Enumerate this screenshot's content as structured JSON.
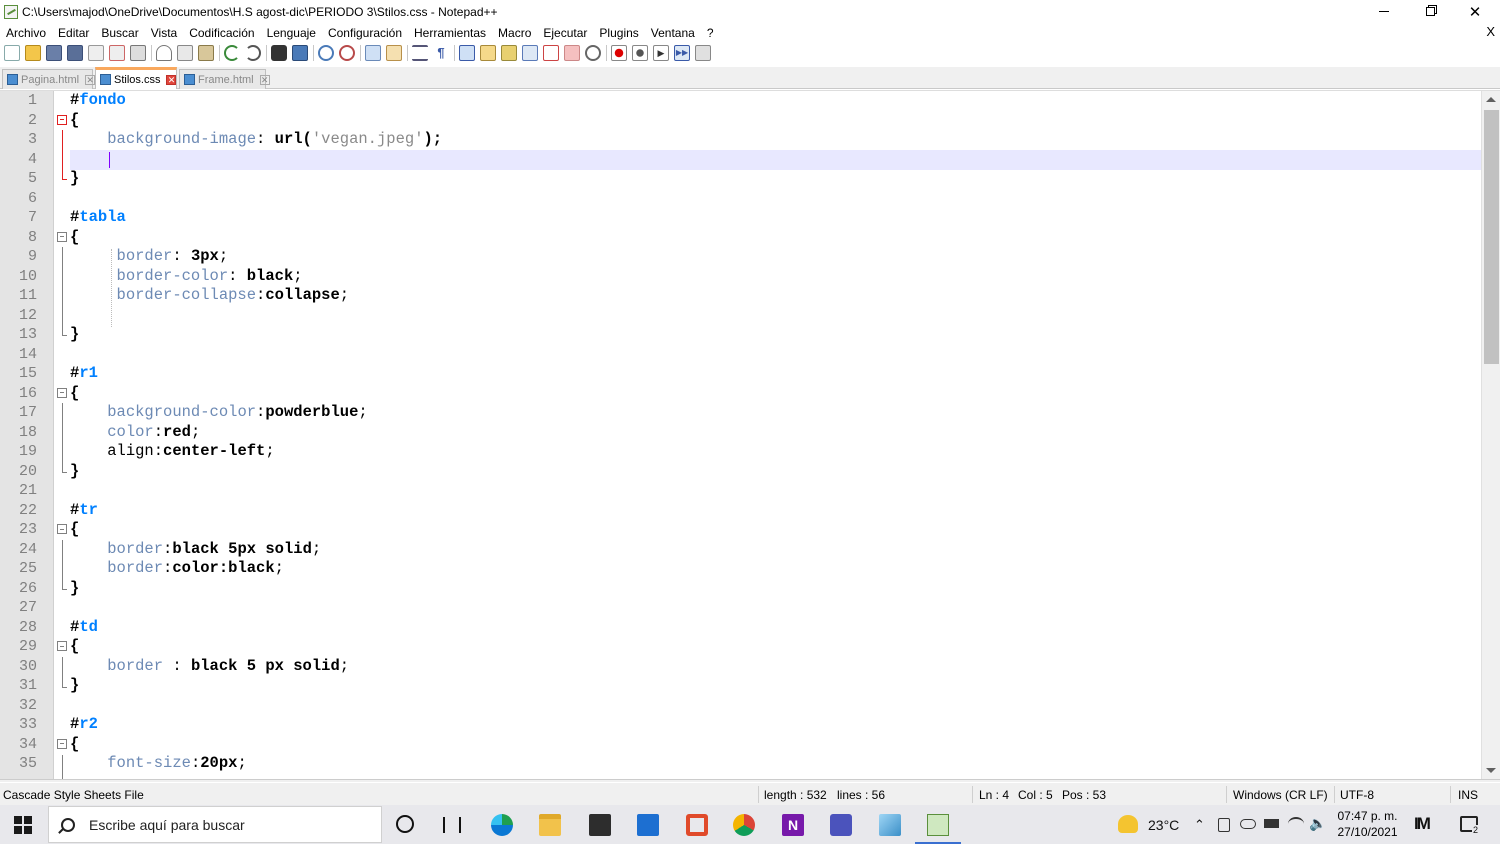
{
  "window": {
    "title": "C:\\Users\\majod\\OneDrive\\Documentos\\H.S agost-dic\\PERIODO 3\\Stilos.css - Notepad++"
  },
  "menu": [
    "Archivo",
    "Editar",
    "Buscar",
    "Vista",
    "Codificación",
    "Lenguaje",
    "Configuración",
    "Herramientas",
    "Macro",
    "Ejecutar",
    "Plugins",
    "Ventana",
    "?"
  ],
  "menu_close": "X",
  "tabs": [
    {
      "label": "Pagina.html",
      "active": false
    },
    {
      "label": "Stilos.css",
      "active": true
    },
    {
      "label": "Frame.html",
      "active": false
    }
  ],
  "editor": {
    "line_numbers": [
      "1",
      "2",
      "3",
      "4",
      "5",
      "6",
      "7",
      "8",
      "9",
      "10",
      "11",
      "12",
      "13",
      "14",
      "15",
      "16",
      "17",
      "18",
      "19",
      "20",
      "21",
      "22",
      "23",
      "24",
      "25",
      "26",
      "27",
      "28",
      "29",
      "30",
      "31",
      "32",
      "33",
      "34",
      "35"
    ],
    "code": {
      "l1_sel": "fondo",
      "l3_prop": "background-image",
      "l3_fn": "url(",
      "l3_str": "'vegan.jpeg'",
      "l3_end": ");",
      "l7_sel": "tabla",
      "l9_prop": "border",
      "l9_val": "3px",
      "l10_prop": "border-color",
      "l10_val": "black",
      "l11_prop": "border-collapse",
      "l11_val": "collapse",
      "l15_sel": "r1",
      "l17_prop": "background-color",
      "l17_val": "powderblue",
      "l18_prop": "color",
      "l18_val": "red",
      "l19_prop": "align",
      "l19_val": "center-left",
      "l22_sel": "tr",
      "l24_prop": "border",
      "l24_val": "black 5px solid",
      "l25_prop": "border",
      "l25_val": "color:black",
      "l28_sel": "td",
      "l30_prop": "border",
      "l30_val": "black 5 px solid",
      "l33_sel": "r2",
      "l35_prop": "font-size",
      "l35_val": "20px"
    }
  },
  "status": {
    "file_type": "Cascade Style Sheets File",
    "length": "length : 532",
    "lines": "lines : 56",
    "ln": "Ln : 4",
    "col": "Col : 5",
    "pos": "Pos : 53",
    "eol": "Windows (CR LF)",
    "encoding": "UTF-8",
    "mode": "INS"
  },
  "taskbar": {
    "search_placeholder": "Escribe aquí para buscar",
    "temperature": "23°C",
    "time": "07:47 p. m.",
    "date": "27/10/2021",
    "notification_count": "2"
  },
  "colors": {
    "selector": "#0080ff",
    "property": "#6d8ab4",
    "current_line": "#e8e8ff",
    "caret": "#8000ff",
    "active_tab_accent": "#f9a85d"
  }
}
